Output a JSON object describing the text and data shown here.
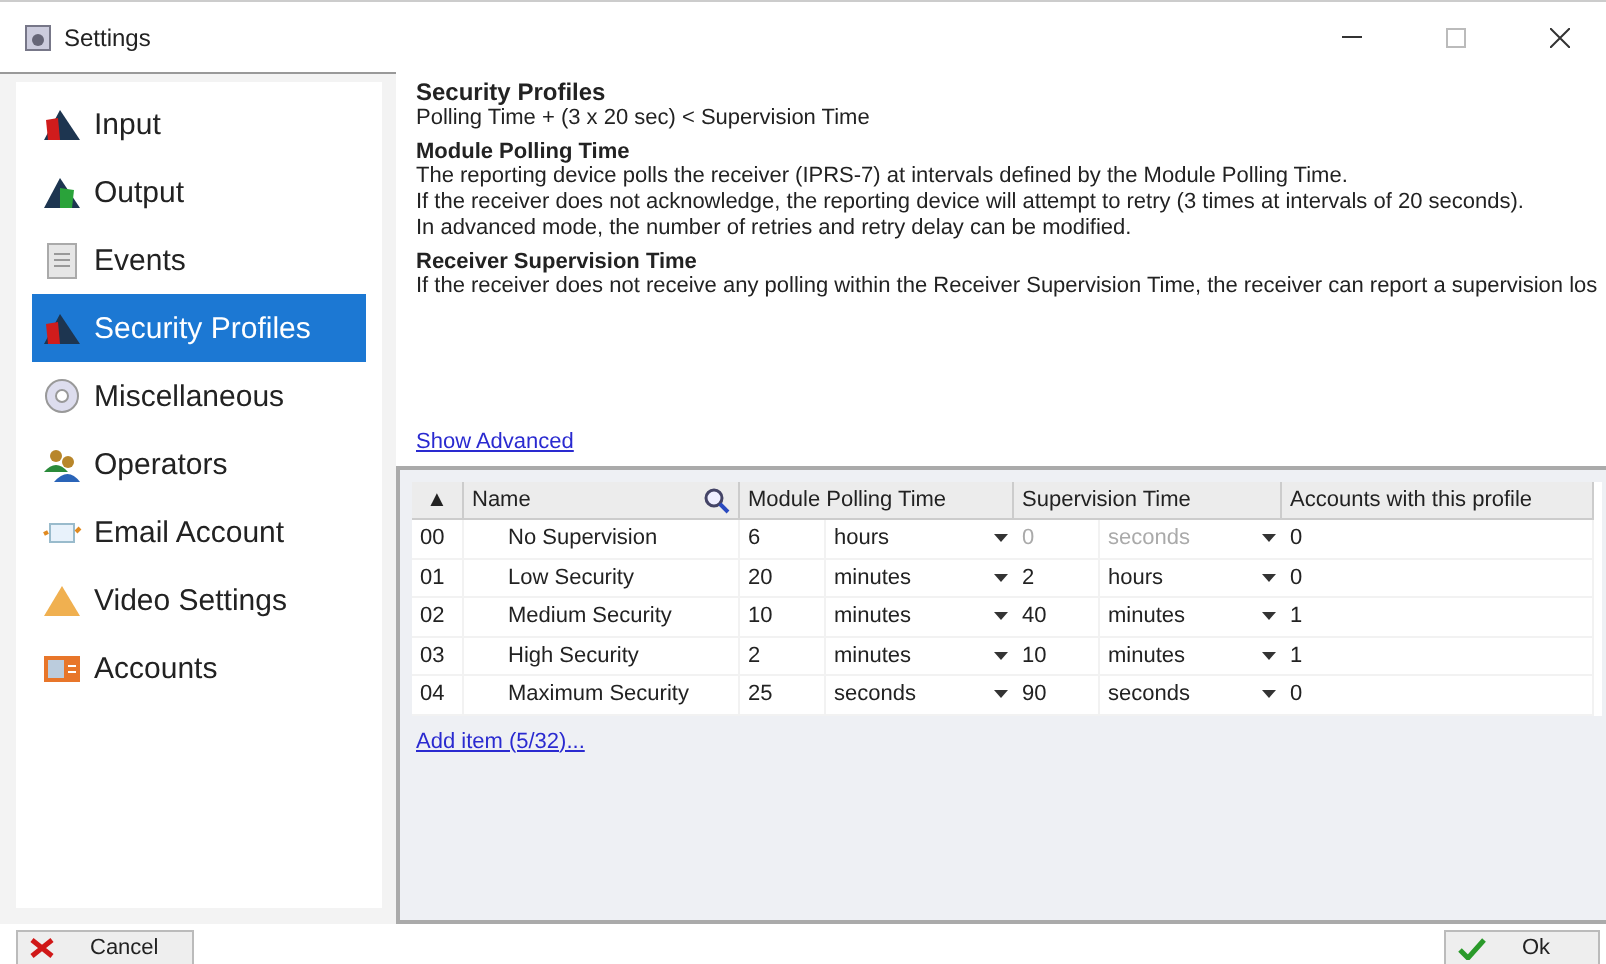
{
  "window": {
    "title": "Settings"
  },
  "sidebar": {
    "items": [
      {
        "label": "Input",
        "kind": "input",
        "selected": false
      },
      {
        "label": "Output",
        "kind": "output",
        "selected": false
      },
      {
        "label": "Events",
        "kind": "events",
        "selected": false
      },
      {
        "label": "Security Profiles",
        "kind": "security",
        "selected": true
      },
      {
        "label": "Miscellaneous",
        "kind": "misc",
        "selected": false
      },
      {
        "label": "Operators",
        "kind": "operators",
        "selected": false
      },
      {
        "label": "Email Account",
        "kind": "email",
        "selected": false
      },
      {
        "label": "Video Settings",
        "kind": "video",
        "selected": false
      },
      {
        "label": "Accounts",
        "kind": "accounts",
        "selected": false
      }
    ]
  },
  "help": {
    "title": "Security Profiles",
    "formula": "Polling Time + (3 x 20 sec) < Supervision Time",
    "sections": [
      {
        "heading": "Module Polling Time",
        "lines": [
          "The reporting device polls the receiver (IPRS-7) at intervals defined by the Module Polling Time.",
          "If the receiver does not acknowledge, the reporting device will attempt to retry (3 times at intervals of 20 seconds).",
          "In advanced mode, the number of retries and retry delay can be modified."
        ]
      },
      {
        "heading": "Receiver Supervision Time",
        "lines": [
          "If the receiver does not receive any polling within the Receiver Supervision Time, the receiver can report a supervision los"
        ]
      }
    ],
    "link": "Show Advanced"
  },
  "table": {
    "sort_glyph": "▲",
    "columns": [
      "Name",
      "Module Polling Time",
      "Supervision Time",
      "Accounts with this profile"
    ],
    "rows": [
      {
        "id": "00",
        "name": "No Supervision",
        "poll_value": "6",
        "poll_unit": "hours",
        "sup_value": "0",
        "sup_unit": "seconds",
        "sup_disabled": true,
        "accounts": "0"
      },
      {
        "id": "01",
        "name": "Low Security",
        "poll_value": "20",
        "poll_unit": "minutes",
        "sup_value": "2",
        "sup_unit": "hours",
        "sup_disabled": false,
        "accounts": "0"
      },
      {
        "id": "02",
        "name": "Medium Security",
        "poll_value": "10",
        "poll_unit": "minutes",
        "sup_value": "40",
        "sup_unit": "minutes",
        "sup_disabled": false,
        "accounts": "1"
      },
      {
        "id": "03",
        "name": "High Security",
        "poll_value": "2",
        "poll_unit": "minutes",
        "sup_value": "10",
        "sup_unit": "minutes",
        "sup_disabled": false,
        "accounts": "1"
      },
      {
        "id": "04",
        "name": "Maximum Security",
        "poll_value": "25",
        "poll_unit": "seconds",
        "sup_value": "90",
        "sup_unit": "seconds",
        "sup_disabled": false,
        "accounts": "0"
      }
    ],
    "add_link": "Add item (5/32)..."
  },
  "buttons": [
    {
      "label": "Cancel",
      "kind": "cancel"
    },
    {
      "label": "Ok",
      "kind": "ok"
    }
  ]
}
